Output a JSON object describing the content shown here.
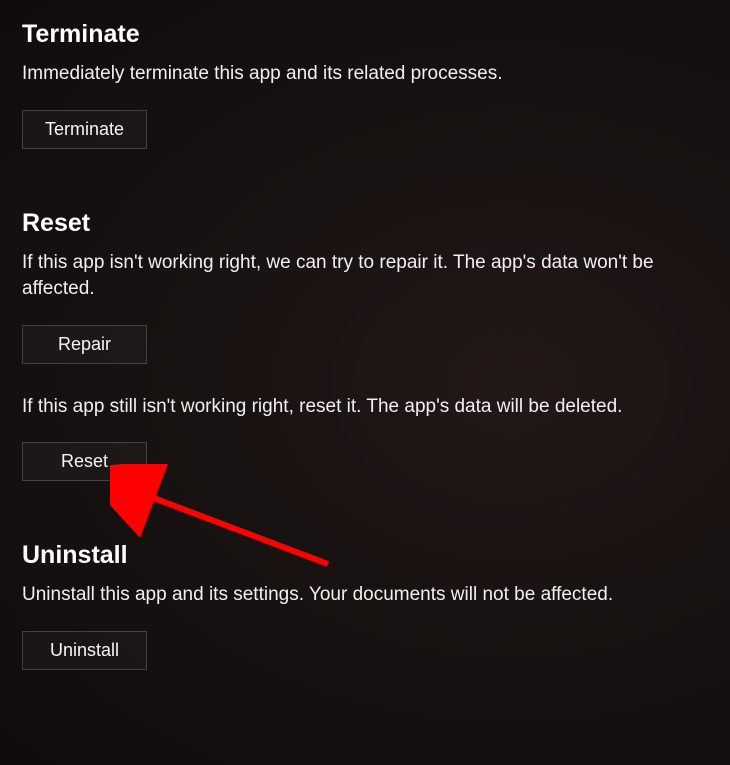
{
  "sections": {
    "terminate": {
      "title": "Terminate",
      "desc": "Immediately terminate this app and its related processes.",
      "button": "Terminate"
    },
    "reset": {
      "title": "Reset",
      "repair_desc": "If this app isn't working right, we can try to repair it. The app's data won't be affected.",
      "repair_button": "Repair",
      "reset_desc": "If this app still isn't working right, reset it. The app's data will be deleted.",
      "reset_button": "Reset"
    },
    "uninstall": {
      "title": "Uninstall",
      "desc": "Uninstall this app and its settings. Your documents will not be affected.",
      "button": "Uninstall"
    }
  },
  "annotation": {
    "arrow_target": "reset-button",
    "color": "#ff0000"
  }
}
